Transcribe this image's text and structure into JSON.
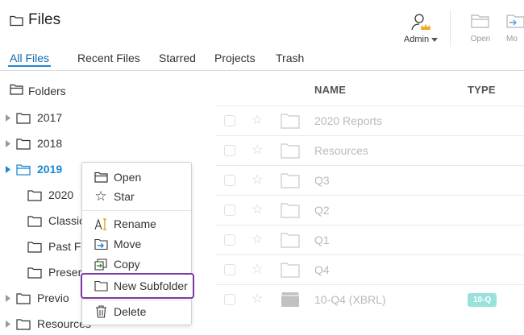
{
  "header": {
    "title": "Files"
  },
  "toolbar": {
    "admin_label": "Admin",
    "open_label": "Open",
    "move_label": "Mo"
  },
  "tabs": [
    "All Files",
    "Recent Files",
    "Starred",
    "Projects",
    "Trash"
  ],
  "sidebar": {
    "heading": "Folders",
    "items": [
      "2017",
      "2018",
      "2019",
      "2020",
      "Classic",
      "Past Fi",
      "Preser",
      "Previo",
      "Resources"
    ]
  },
  "table": {
    "columns": [
      "NAME",
      "TYPE"
    ],
    "rows": [
      {
        "name": "2020 Reports",
        "type": ""
      },
      {
        "name": "Resources",
        "type": ""
      },
      {
        "name": "Q3",
        "type": ""
      },
      {
        "name": "Q2",
        "type": ""
      },
      {
        "name": "Q1",
        "type": ""
      },
      {
        "name": "Q4",
        "type": ""
      },
      {
        "name": "10-Q4 (XBRL)",
        "type": "10-Q"
      }
    ]
  },
  "context_menu": {
    "items": [
      "Open",
      "Star",
      "Rename",
      "Move",
      "Copy",
      "New Subfolder",
      "Delete"
    ]
  },
  "colors": {
    "accent": "#1d86d4",
    "highlight_border": "#7c3aa0",
    "badge": "#1fc1b3",
    "admin_crown": "#f2a61c"
  },
  "icons": {
    "header": "folder-icon",
    "admin": "user-crown-icon",
    "open": "folder-open-icon",
    "move": "move-icon",
    "menu": [
      "folder-open-icon",
      "star-icon",
      "rename-icon",
      "move-icon",
      "copy-icon",
      "new-folder-icon",
      "trash-icon"
    ]
  }
}
